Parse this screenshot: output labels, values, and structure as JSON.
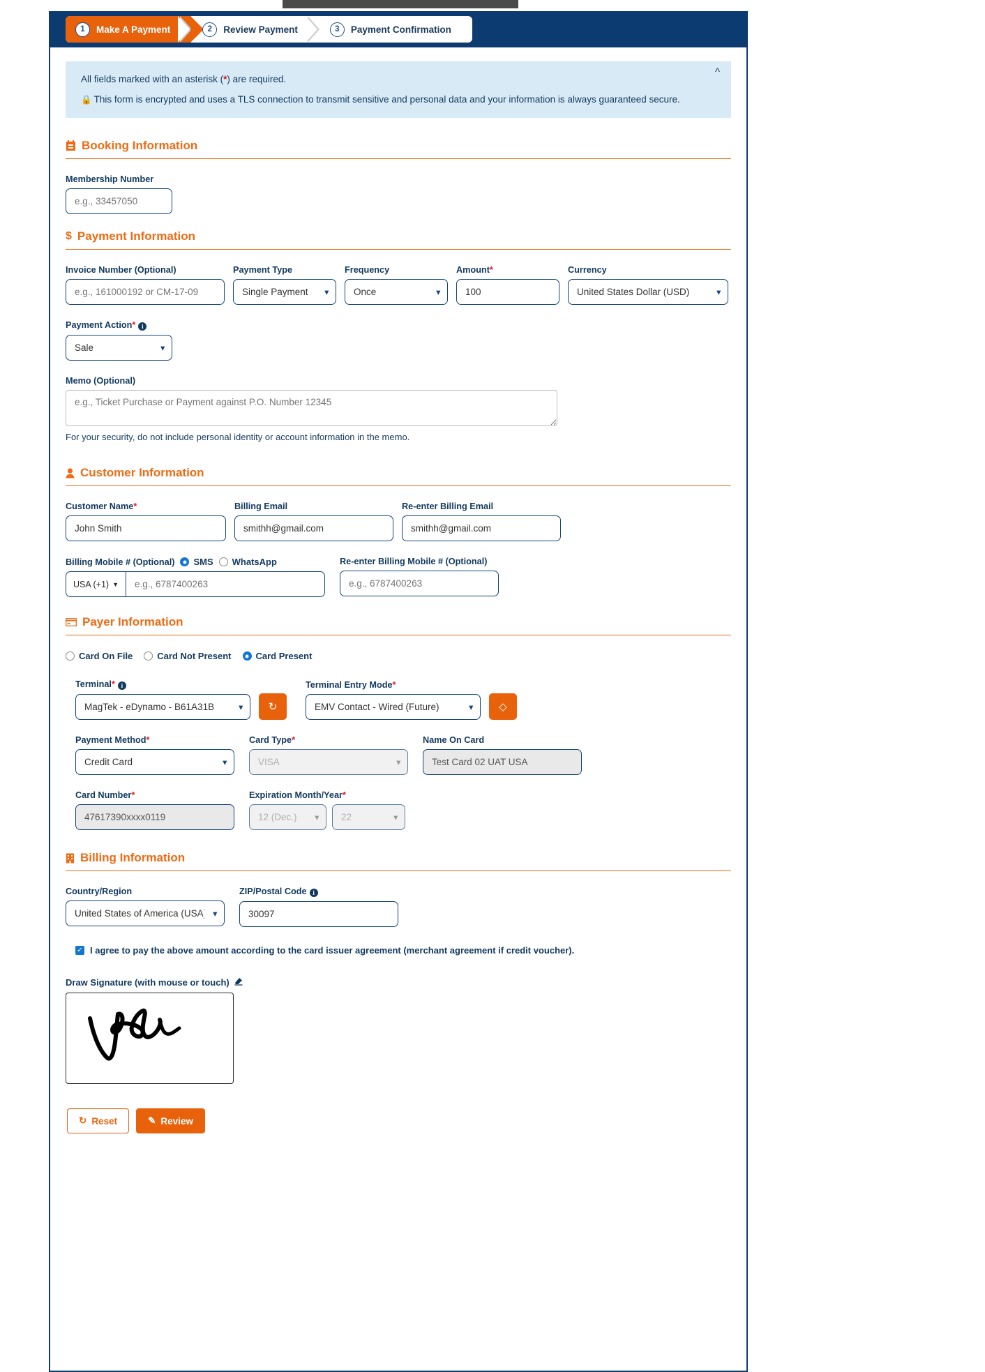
{
  "stepper": {
    "steps": [
      {
        "num": "1",
        "label": "Make A Payment",
        "active": true
      },
      {
        "num": "2",
        "label": "Review Payment",
        "active": false
      },
      {
        "num": "3",
        "label": "Payment Confirmation",
        "active": false
      }
    ]
  },
  "notice": {
    "line1_prefix": "All fields marked with an asterisk (",
    "asterisk": "*",
    "line1_suffix": ") are required.",
    "line2": "This form is encrypted and uses a TLS connection to transmit sensitive and personal data and your information is always guaranteed secure.",
    "collapse_icon": "chevron-up"
  },
  "booking": {
    "heading": "Booking Information",
    "membership_label": "Membership Number",
    "membership_placeholder": "e.g., 33457050",
    "membership_value": ""
  },
  "payment": {
    "heading": "Payment Information",
    "invoice_label": "Invoice Number (Optional)",
    "invoice_placeholder": "e.g., 161000192 or CM-17-09",
    "invoice_value": "",
    "payment_type_label": "Payment Type",
    "payment_type_value": "Single Payment",
    "frequency_label": "Frequency",
    "frequency_value": "Once",
    "amount_label": "Amount",
    "amount_value": "100",
    "currency_label": "Currency",
    "currency_value": "United States Dollar (USD)",
    "payment_action_label": "Payment Action",
    "payment_action_value": "Sale",
    "memo_label": "Memo (Optional)",
    "memo_placeholder": "e.g., Ticket Purchase or Payment against P.O. Number 12345",
    "memo_value": "",
    "memo_note": "For your security, do not include personal identity or account information in the memo."
  },
  "customer": {
    "heading": "Customer Information",
    "name_label": "Customer Name",
    "name_value": "John Smith",
    "email_label": "Billing Email",
    "email_value": "smithh@gmail.com",
    "reenter_email_label": "Re-enter Billing Email",
    "reenter_email_value": "smithh@gmail.com",
    "mobile_label": "Billing Mobile # (Optional)",
    "sms_label": "SMS",
    "whatsapp_label": "WhatsApp",
    "country_code": "USA (+1)",
    "mobile_placeholder": "e.g., 6787400263",
    "mobile_value": "",
    "reenter_mobile_label": "Re-enter Billing Mobile # (Optional)",
    "reenter_mobile_placeholder": "e.g., 6787400263",
    "reenter_mobile_value": ""
  },
  "payer": {
    "heading": "Payer Information",
    "option_card_on_file": "Card On File",
    "option_card_not_present": "Card Not Present",
    "option_card_present": "Card Present",
    "selected_option": "Card Present",
    "terminal_label": "Terminal",
    "terminal_value": "MagTek - eDynamo - B61A31B",
    "terminal_refresh_icon": "refresh-icon",
    "entry_mode_label": "Terminal Entry Mode",
    "entry_mode_value": "EMV Contact - Wired (Future)",
    "entry_mode_action_icon": "card-swipe-icon",
    "payment_method_label": "Payment Method",
    "payment_method_value": "Credit Card",
    "card_type_label": "Card Type",
    "card_type_value": "VISA",
    "name_on_card_label": "Name On Card",
    "name_on_card_value": "Test Card 02 UAT USA",
    "card_number_label": "Card Number",
    "card_number_value": "47617390xxxx0119",
    "expiration_label": "Expiration Month/Year",
    "exp_month_value": "12 (Dec.)",
    "exp_year_value": "22"
  },
  "billing": {
    "heading": "Billing Information",
    "country_label": "Country/Region",
    "country_value": "United States of America (USA)",
    "zip_label": "ZIP/Postal Code",
    "zip_value": "30097",
    "agree_text": "I agree to pay the above amount according to the card issuer agreement (merchant agreement if credit voucher).",
    "agree_checked": true,
    "signature_label": "Draw Signature (with mouse or touch)",
    "signature_clear_icon": "eraser-icon"
  },
  "actions": {
    "reset_label": "Reset",
    "review_label": "Review"
  },
  "colors": {
    "brand_orange": "#e8620c",
    "brand_navy": "#0b3b71",
    "notice_bg": "#d8eaf5",
    "required_red": "#e01b24"
  }
}
